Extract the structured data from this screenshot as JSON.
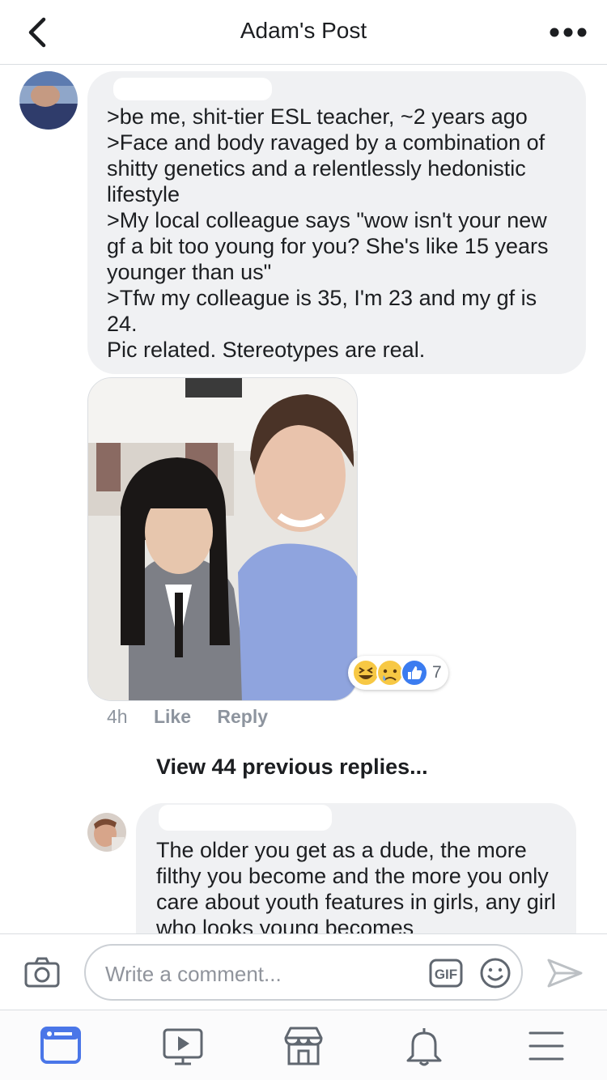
{
  "header": {
    "title": "Adam's Post",
    "back_icon": "chevron-left-icon",
    "more_icon": "ellipsis-icon"
  },
  "main_comment": {
    "text": ">be me, shit-tier ESL teacher, ~2 years ago\n>Face and body ravaged by a combination of shitty genetics and a relentlessly hedonistic lifestyle\n>My local colleague says \"wow isn't your new gf a bit too young for you? She's like 15 years younger than us\"\n>Tfw my colleague is 35, I'm 23 and my gf is 24.\nPic related. Stereotypes are real.",
    "reactions": {
      "count": "7",
      "types": [
        "haha",
        "sad",
        "like"
      ]
    },
    "time": "4h",
    "like_label": "Like",
    "reply_label": "Reply"
  },
  "view_previous": "View 44 previous replies...",
  "reply_comment": {
    "text": "The older you get as a dude, the more filthy you become and the more you only care about youth features in girls, any girl who looks young becomes"
  },
  "composer": {
    "placeholder": "Write a comment...",
    "gif_label": "GIF"
  },
  "tabbar": {
    "items": [
      "news-feed-icon",
      "watch-icon",
      "marketplace-icon",
      "notifications-icon",
      "menu-icon"
    ],
    "active": "news-feed-icon"
  },
  "colors": {
    "accent": "#4a76e8",
    "bubble": "#f0f1f3",
    "muted": "#8d949e"
  }
}
